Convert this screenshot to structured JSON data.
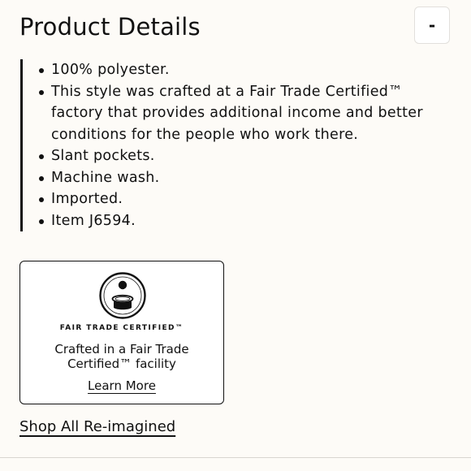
{
  "header": {
    "title": "Product Details",
    "toggle_label": "-"
  },
  "details": {
    "items": [
      "100% polyester.",
      "This style was crafted at a Fair Trade Certified™ factory that provides additional income and better conditions for the people who work there.",
      "Slant pockets.",
      "Machine wash.",
      "Imported.",
      "Item J6594."
    ]
  },
  "fair_trade_card": {
    "logo_icon": "fair-trade-certified-logo-icon",
    "brand_text": "FAIR TRADE CERTIFIED™",
    "description": "Crafted in a Fair Trade Certified™ facility",
    "learn_more_label": "Learn More"
  },
  "footer": {
    "shop_link_label": "Shop All Re-imagined"
  }
}
